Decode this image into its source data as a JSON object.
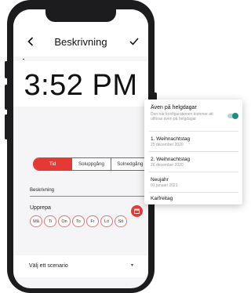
{
  "header": {
    "back_icon": "chevron-left-icon",
    "title": "Beskrivning",
    "confirm_icon": "check-icon"
  },
  "time": {
    "value": "3:52 PM"
  },
  "segmented": {
    "items": [
      "Tid",
      "Soluppgång",
      "Solnedgång"
    ],
    "selected": "Tid",
    "accent": "#e53935"
  },
  "description": {
    "label": "Beskrivning"
  },
  "repeat": {
    "label": "Upprepa",
    "days": [
      "Må",
      "Ti",
      "On",
      "To",
      "Fr",
      "Lö",
      "Sö"
    ],
    "calendar_icon": "calendar-icon"
  },
  "scenario": {
    "label": "Välj ett scenario"
  },
  "popup": {
    "holidays": {
      "title": "Även på helgdagar",
      "subtitle": "Den här konfigurationen kommer att utföras även på helgdagar",
      "toggle_on": true,
      "toggle_color": "#1c8f80"
    },
    "items": [
      {
        "title": "1. Weihnachtstag",
        "date": "25 december 2020"
      },
      {
        "title": "2. Weihnachtstag",
        "date": "26 december 2020"
      },
      {
        "title": "Neujahr",
        "date": "01 januari 2021"
      },
      {
        "title": "Karfreitag",
        "date": ""
      }
    ]
  }
}
